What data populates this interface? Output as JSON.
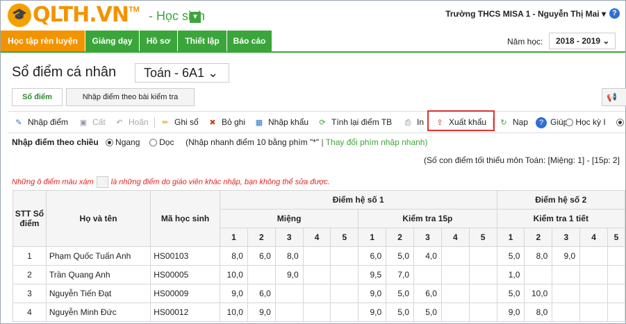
{
  "brand": {
    "name": "QLTH.VN",
    "tm": "TM",
    "role": "- Học sinh"
  },
  "header": {
    "school_user": "Trường THCS MISA 1  - Nguyễn Thị Mai ▾",
    "help": "?"
  },
  "nav": {
    "items": [
      "Học tập rèn luyện",
      "Giảng dạy",
      "Hồ sơ",
      "Thiết lập",
      "Báo cáo"
    ],
    "year_label": "Năm học:",
    "year_value": "2018 - 2019 ⌄"
  },
  "page": {
    "title": "Sổ điểm cá nhân",
    "subject": "Toán - 6A1 ⌄"
  },
  "tabs": [
    "Sổ điểm",
    "Nhập điểm theo bài kiểm tra"
  ],
  "toolbar": {
    "nhap_diem": "Nhập điểm",
    "cat": "Cất",
    "hoan": "Hoãn",
    "ghi_so": "Ghi sổ",
    "bo_ghi": "Bỏ ghi",
    "nhap_khau": "Nhập khẩu",
    "tinh_lai": "Tính lại điểm TB",
    "in": "In",
    "xuat_khau": "Xuất khẩu",
    "nap": "Nạp",
    "giup": "Giúp",
    "hoc_ky": "Học kỳ I"
  },
  "mode": {
    "label": "Nhập điểm theo chiều",
    "ngang": "Ngang",
    "doc": "Dọc",
    "hint": "(Nhập nhanh điểm 10 bằng phím \"*\"",
    "change": "Thay đổi phím nhập nhanh)"
  },
  "min_scores": "(Số con điểm tối thiểu môn Toán: [Miệng: 1] - [15p: 2]",
  "note": {
    "before": "Những ô điểm màu xám",
    "after": "là những điểm do giáo viên khác nhập, bạn không thể sửa được."
  },
  "table": {
    "h_stt": "STT Sổ điểm",
    "h_name": "Họ và tên",
    "h_code": "Mã học sinh",
    "h_coef1": "Điểm hệ số 1",
    "h_coef2": "Điểm hệ số 2",
    "h_mieng": "Miệng",
    "h_15p": "Kiểm tra 15p",
    "h_1tiet": "Kiểm tra 1 tiết",
    "cols": [
      "1",
      "2",
      "3",
      "4",
      "5"
    ],
    "rows": [
      {
        "stt": "1",
        "name": "Phạm Quốc Tuấn Anh",
        "code": "HS00103",
        "m": [
          "8,0",
          "6,0",
          "8,0",
          "",
          ""
        ],
        "k15": [
          "6,0",
          "5,0",
          "4,0",
          "",
          ""
        ],
        "k1t": [
          "5,0",
          "8,0",
          "9,0",
          "",
          ""
        ]
      },
      {
        "stt": "2",
        "name": "Trần Quang Anh",
        "code": "HS00005",
        "m": [
          "10,0",
          "",
          "9,0",
          "",
          ""
        ],
        "k15": [
          "9,5",
          "7,0",
          "",
          "",
          ""
        ],
        "k1t": [
          "1,0",
          "",
          "",
          "",
          ""
        ]
      },
      {
        "stt": "3",
        "name": "Nguyễn Tiến Đạt",
        "code": "HS00009",
        "m": [
          "9,0",
          "6,0",
          "",
          "",
          ""
        ],
        "k15": [
          "9,0",
          "5,0",
          "6,0",
          "",
          ""
        ],
        "k1t": [
          "5,0",
          "10,0",
          "",
          "",
          ""
        ]
      },
      {
        "stt": "4",
        "name": "Nguyễn Minh Đức",
        "code": "HS00012",
        "m": [
          "10,0",
          "9,0",
          "",
          "",
          ""
        ],
        "k15": [
          "9,0",
          "5,0",
          "5,0",
          "",
          ""
        ],
        "k1t": [
          "9,0",
          "8,0",
          "",
          "",
          ""
        ]
      }
    ]
  }
}
